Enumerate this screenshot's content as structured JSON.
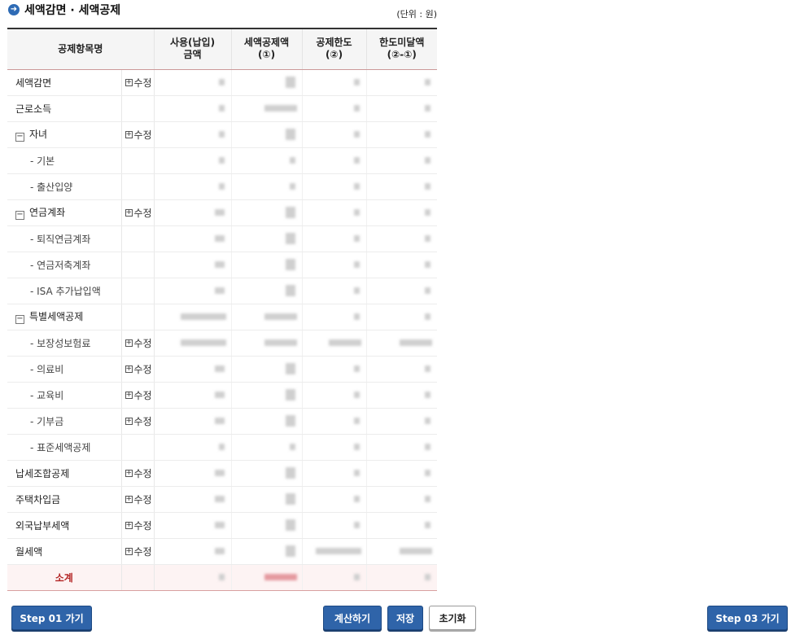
{
  "section": {
    "icon": "arrow-right-circle-icon",
    "title": "세액감면 · 세액공제",
    "unit": "(단위 : 원)"
  },
  "table": {
    "headers": [
      "공제항목명",
      "사용(납입)\n금액",
      "세액공제액\n(①)",
      "공제한도\n(②)",
      "한도미달액\n(②-①)"
    ],
    "rows": [
      {
        "label": "세액감면",
        "edit": "수정"
      },
      {
        "label": "근로소득"
      },
      {
        "label": "자녀",
        "edit": "수정",
        "toggle": "−"
      },
      {
        "label": "- 기본"
      },
      {
        "label": "- 출산입양"
      },
      {
        "label": "연금계좌",
        "edit": "수정",
        "toggle": "−"
      },
      {
        "label": "- 퇴직연금계좌"
      },
      {
        "label": "- 연금저축계좌"
      },
      {
        "label": "- ISA 추가납입액"
      },
      {
        "label": "특별세액공제",
        "toggle": "−"
      },
      {
        "label": "- 보장성보험료",
        "edit": "수정"
      },
      {
        "label": "- 의료비",
        "edit": "수정"
      },
      {
        "label": "- 교육비",
        "edit": "수정"
      },
      {
        "label": "- 기부금",
        "edit": "수정"
      },
      {
        "label": "- 표준세액공제"
      },
      {
        "label": "납세조합공제",
        "edit": "수정"
      },
      {
        "label": "주택차입금",
        "edit": "수정"
      },
      {
        "label": "외국납부세액",
        "edit": "수정"
      },
      {
        "label": "월세액",
        "edit": "수정"
      }
    ],
    "subtotal_label": "소계",
    "plus_glyph": "+"
  },
  "buttons": {
    "step01": "Step 01 가기",
    "calculate": "계산하기",
    "save": "저장",
    "reset": "초기화",
    "step03": "Step 03 가기"
  },
  "colors": {
    "accent": "#2f64a9",
    "subtotal": "#b32424",
    "subtotal_bg": "#fdf3f3"
  }
}
